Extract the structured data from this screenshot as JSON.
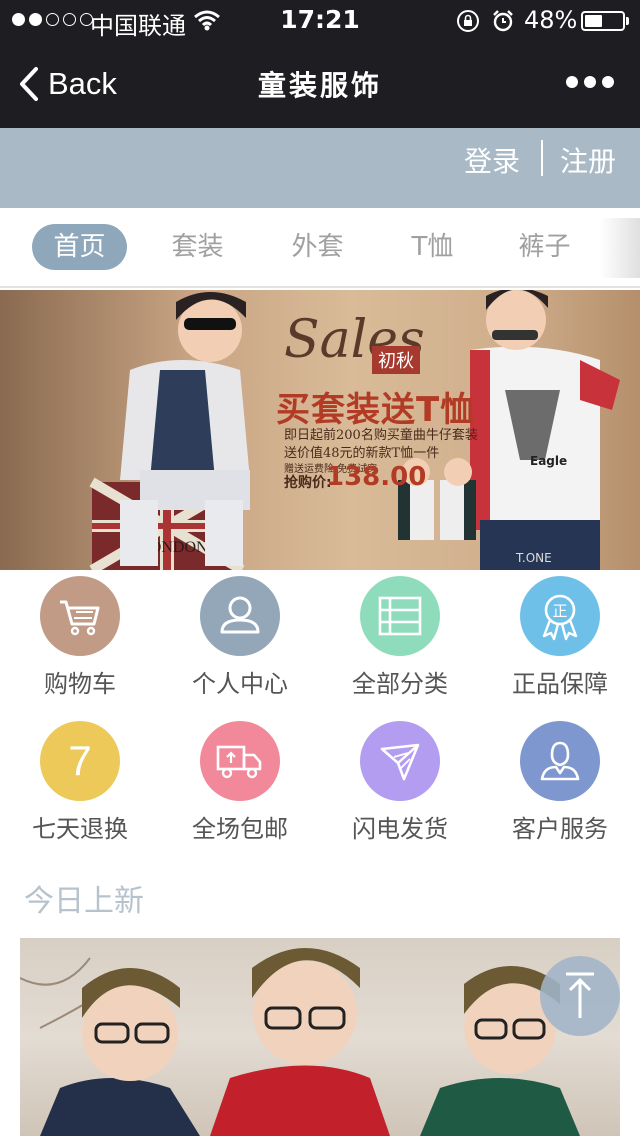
{
  "status_bar": {
    "carrier": "中国联通",
    "time": "17:21",
    "battery_percent": "48%",
    "battery_level": 0.48,
    "signal_bars_filled": 2,
    "signal_bars_total": 5
  },
  "nav": {
    "back_label": "Back",
    "title": "童装服饰"
  },
  "account": {
    "login_label": "登录",
    "register_label": "注册"
  },
  "tabs": [
    {
      "label": "首页",
      "active": true
    },
    {
      "label": "套装",
      "active": false
    },
    {
      "label": "外套",
      "active": false
    },
    {
      "label": "T恤",
      "active": false
    },
    {
      "label": "裤子",
      "active": false
    }
  ],
  "banner": {
    "script_text": "Sales",
    "badge": "初秋",
    "headline": "买套装送T恤",
    "line1": "即日起前200名购买童曲牛仔套装",
    "line2": "送价值48元的新款T恤一件",
    "line3": "赠送运费险 免费试穿",
    "price_label": "抢购价:",
    "price_value": "138.00",
    "box_text": "LONDON",
    "shirt_text": "Eagle",
    "jeans_text": "T.ONE",
    "pager_count": 3,
    "pager_active": 1
  },
  "features": [
    {
      "label": "购物车",
      "icon": "cart-icon",
      "color": "#c29b86"
    },
    {
      "label": "个人中心",
      "icon": "user-icon",
      "color": "#93a7b9"
    },
    {
      "label": "全部分类",
      "icon": "list-icon",
      "color": "#8fdcbd"
    },
    {
      "label": "正品保障",
      "icon": "badge-icon",
      "color": "#6fc0e8"
    },
    {
      "label": "七天退换",
      "icon": "seven-days-icon",
      "color": "#ecc958"
    },
    {
      "label": "全场包邮",
      "icon": "truck-icon",
      "color": "#f2899a"
    },
    {
      "label": "闪电发货",
      "icon": "paper-plane-icon",
      "color": "#b39df0"
    },
    {
      "label": "客户服务",
      "icon": "service-icon",
      "color": "#7e97cf"
    }
  ],
  "icon_glyphs": {
    "badge": "正",
    "seven": "7"
  },
  "section": {
    "title": "今日上新"
  },
  "colors": {
    "nav_bg": "#1e1e22",
    "account_bg": "#a9b9c5",
    "tab_active_bg": "#8fa7bb",
    "section_title": "#b7c3cc"
  }
}
